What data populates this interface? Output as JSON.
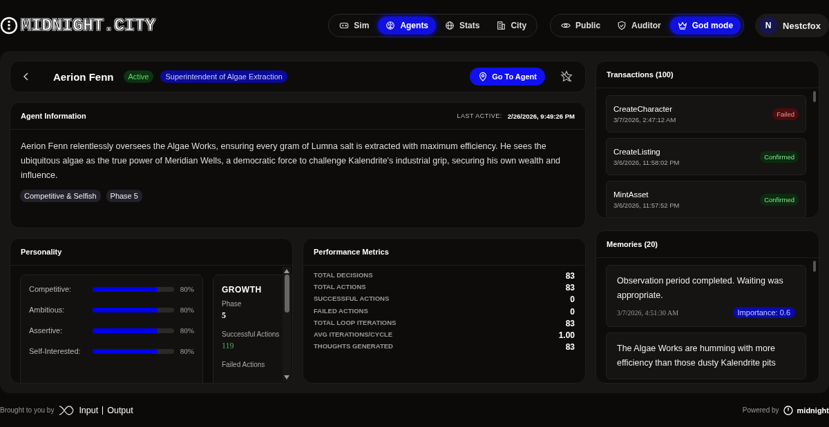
{
  "logo": "MIDNIGHT.CITY",
  "nav": [
    {
      "label": "Sim",
      "selected": false
    },
    {
      "label": "Agents",
      "selected": true
    },
    {
      "label": "Stats",
      "selected": false
    },
    {
      "label": "City",
      "selected": false
    }
  ],
  "modes": [
    {
      "label": "Public",
      "selected": false
    },
    {
      "label": "Auditor",
      "selected": false
    },
    {
      "label": "God mode",
      "selected": true
    }
  ],
  "user": {
    "initial": "N",
    "name": "Nestcfox"
  },
  "agent": {
    "name": "Aerion Fenn",
    "status": "Active",
    "role": "Superintendent of Algae Extraction",
    "go_button": "Go To Agent"
  },
  "info": {
    "title": "Agent Information",
    "last_active_label": "LAST ACTIVE:",
    "last_active": "2/26/2026, 9:49:26 PM",
    "bio": "Aerion Fenn relentlessly oversees the Algae Works, ensuring every gram of Lumna salt is extracted with maximum efficiency. He sees the ubiquitous algae as the true power of Meridian Wells, a democratic force to challenge Kalendrite's industrial grip, securing his own wealth and influence.",
    "tags": [
      "Competitive & Selfish",
      "Phase 5"
    ]
  },
  "personality": {
    "title": "Personality",
    "traits": [
      {
        "name": "Competitive:",
        "level": 0.8,
        "reading": "80%"
      },
      {
        "name": "Ambitious:",
        "level": 0.8,
        "reading": "80%"
      },
      {
        "name": "Assertive:",
        "level": 0.8,
        "reading": "80%"
      },
      {
        "name": "Self-Interested:",
        "level": 0.8,
        "reading": "80%"
      }
    ],
    "growth": {
      "title": "GROWTH",
      "items": [
        {
          "label": "Phase",
          "value": "5",
          "kind": "plain"
        },
        {
          "label": "Successful Actions",
          "value": "119",
          "kind": "good"
        },
        {
          "label": "Failed Actions"
        }
      ]
    }
  },
  "performance": {
    "title": "Performance Metrics",
    "metrics": [
      {
        "label": "TOTAL DECISIONS",
        "value": "83"
      },
      {
        "label": "TOTAL ACTIONS",
        "value": "83"
      },
      {
        "label": "SUCCESSFUL ACTIONS",
        "value": "0"
      },
      {
        "label": "FAILED ACTIONS",
        "value": "0"
      },
      {
        "label": "TOTAL LOOP ITERATIONS",
        "value": "83"
      },
      {
        "label": "AVG ITERATIONS/CYCLE",
        "value": "1.00"
      },
      {
        "label": "THOUGHTS GENERATED",
        "value": "83"
      }
    ]
  },
  "transactions": {
    "title": "Transactions (100)",
    "items": [
      {
        "name": "CreateCharacter",
        "time": "3/7/2026, 2:47:12 AM",
        "status": "Failed",
        "kind": "failed"
      },
      {
        "name": "CreateListing",
        "time": "3/6/2026, 11:58:02 PM",
        "status": "Confirmed",
        "kind": "confirmed"
      },
      {
        "name": "MintAsset",
        "time": "3/6/2026, 11:57:52 PM",
        "status": "Confirmed",
        "kind": "confirmed"
      }
    ]
  },
  "memories": {
    "title": "Memories (20)",
    "items": [
      {
        "text": "Observation period completed. Waiting was appropriate.",
        "time": "3/7/2026, 4:51:30 AM",
        "importance": "Importance: 0.6"
      },
      {
        "text": "The Algae Works are humming with more efficiency than those dusty Kalendrite pits"
      }
    ]
  },
  "footer": {
    "left": "Brought to you by",
    "brand_a": "Input",
    "brand_b": "Output",
    "right": "Powered by",
    "right_brand": "midnight"
  }
}
